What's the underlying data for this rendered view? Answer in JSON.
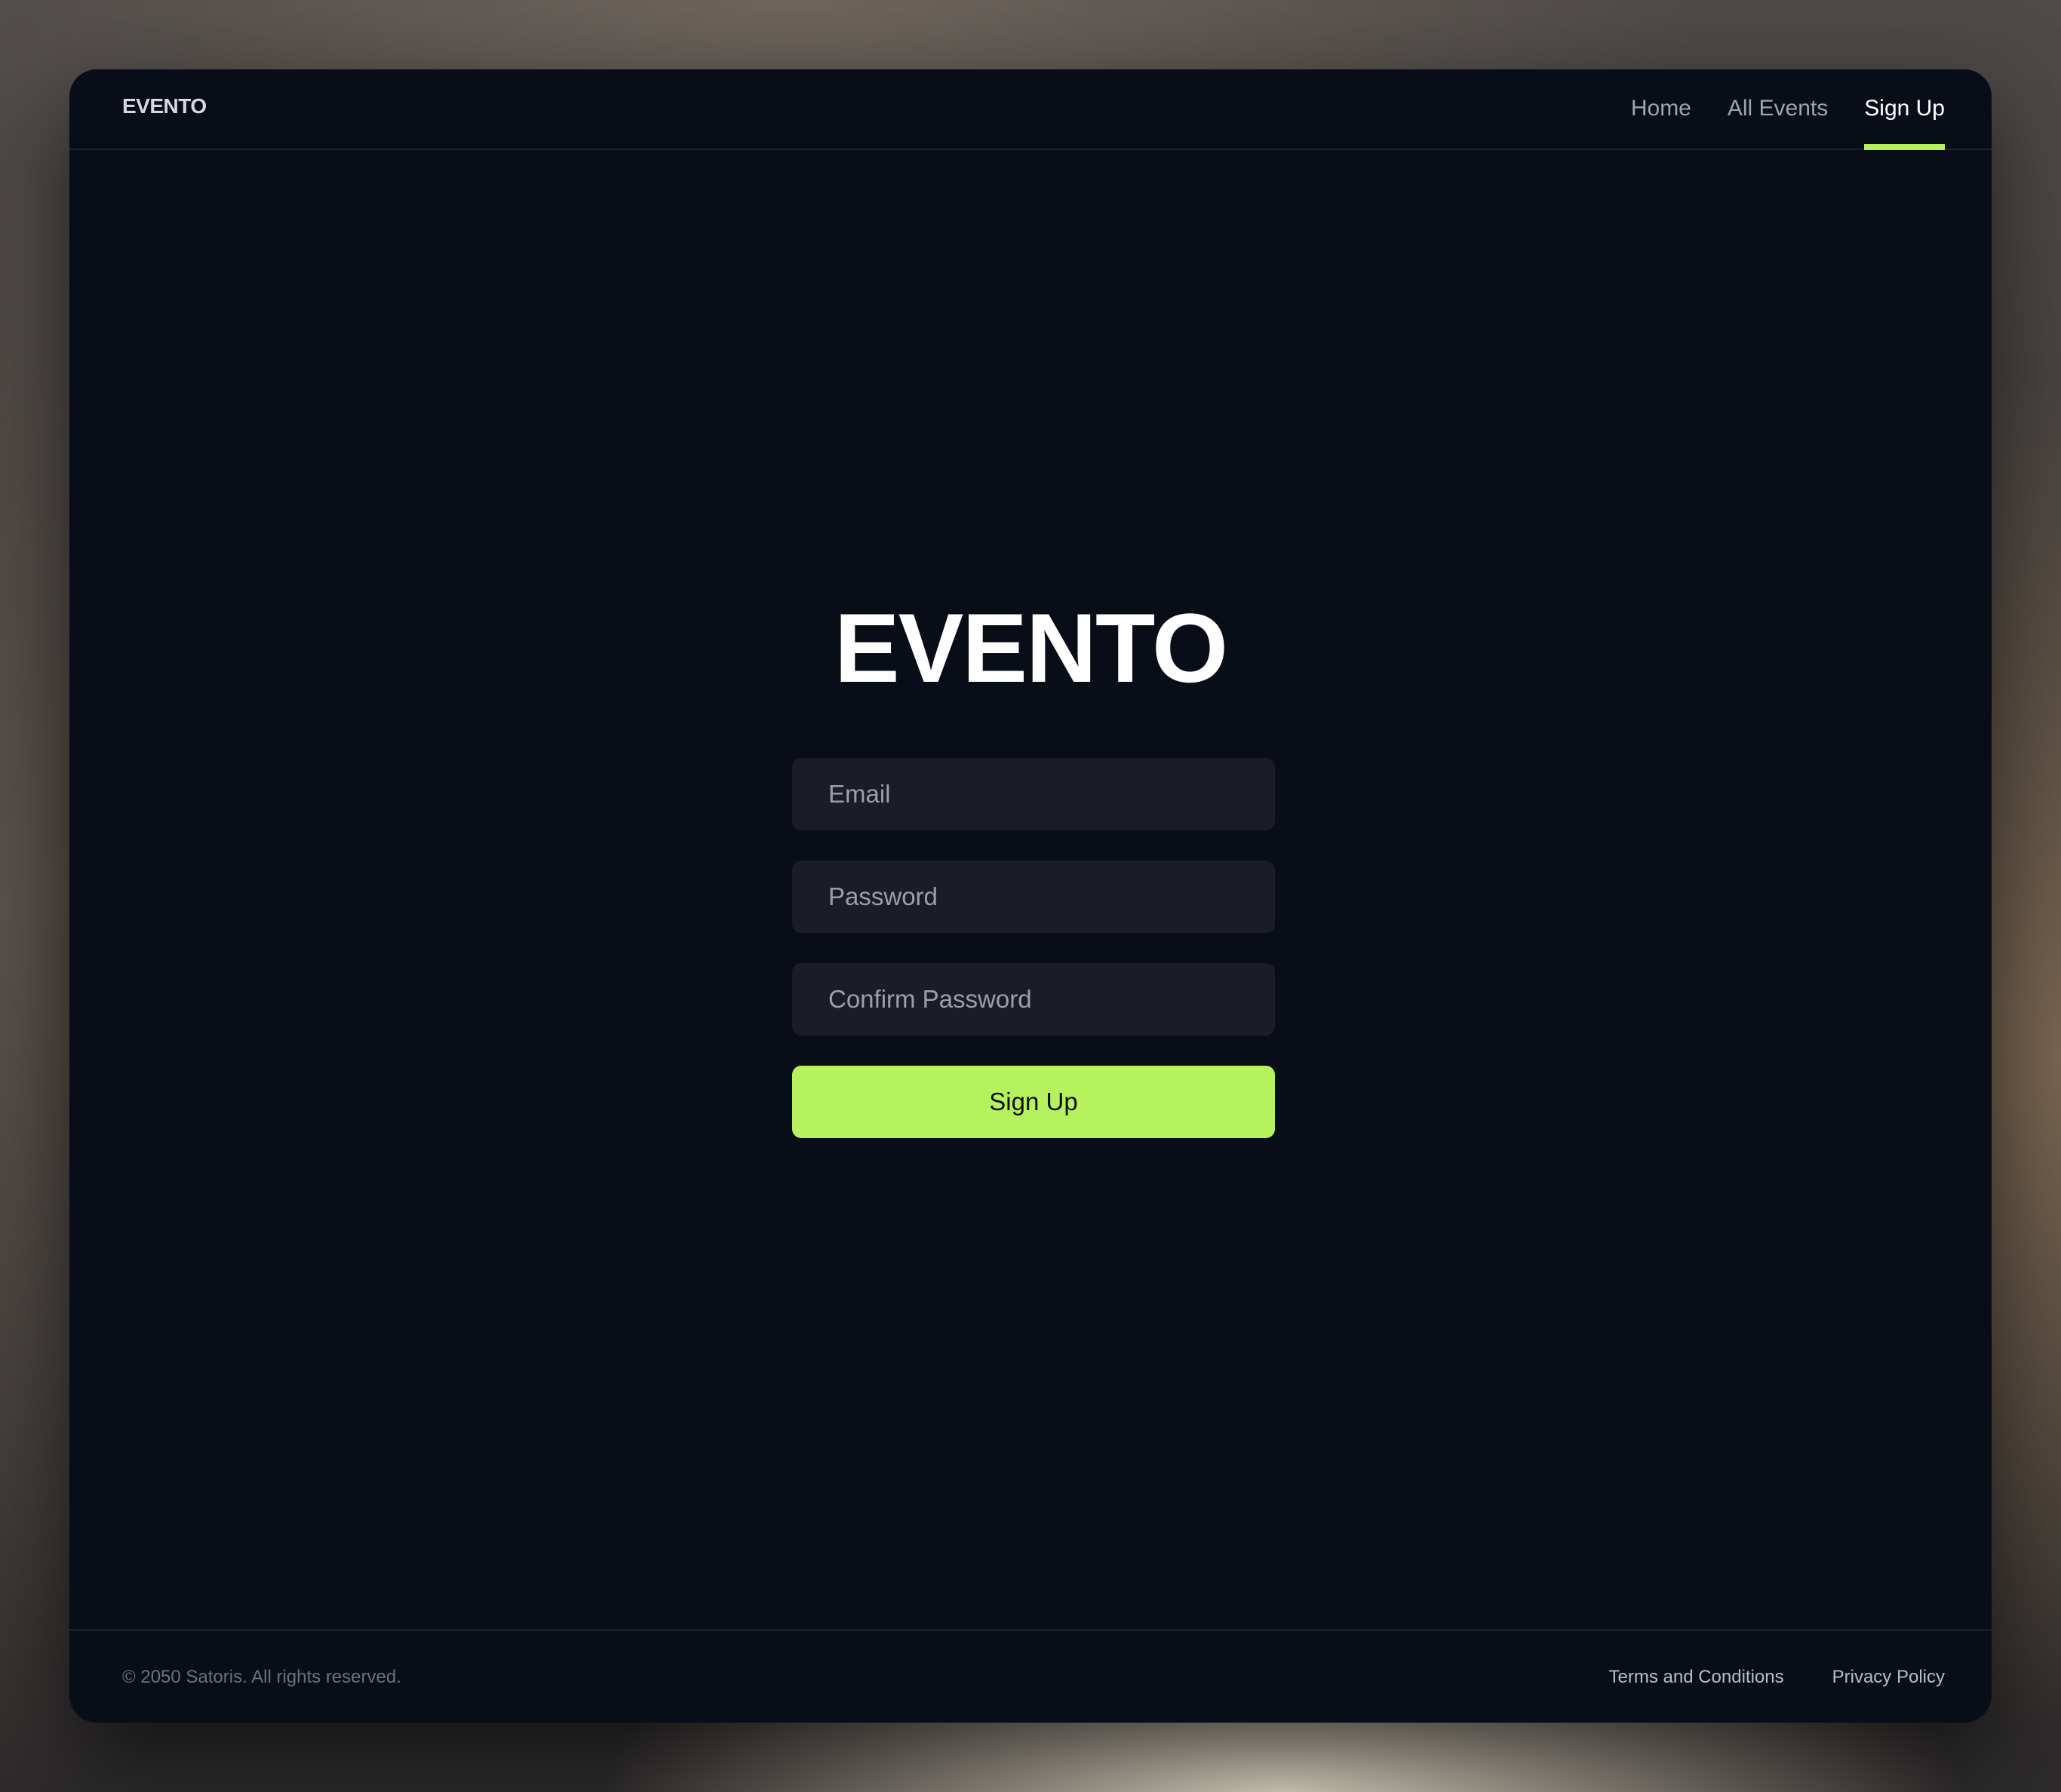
{
  "header": {
    "logo": "EVENTO",
    "nav": [
      {
        "label": "Home",
        "active": false
      },
      {
        "label": "All Events",
        "active": false
      },
      {
        "label": "Sign Up",
        "active": true
      }
    ]
  },
  "main": {
    "title": "EVENTO",
    "form": {
      "email": {
        "placeholder": "Email",
        "value": ""
      },
      "password": {
        "placeholder": "Password",
        "value": ""
      },
      "confirm_password": {
        "placeholder": "Confirm Password",
        "value": ""
      },
      "submit_label": "Sign Up"
    }
  },
  "footer": {
    "copyright": "© 2050 Satoris. All rights reserved.",
    "links": [
      {
        "label": "Terms and Conditions"
      },
      {
        "label": "Privacy Policy"
      }
    ]
  },
  "colors": {
    "accent": "#b6f25e",
    "background": "#090d18",
    "input_background": "#1a1d27"
  }
}
